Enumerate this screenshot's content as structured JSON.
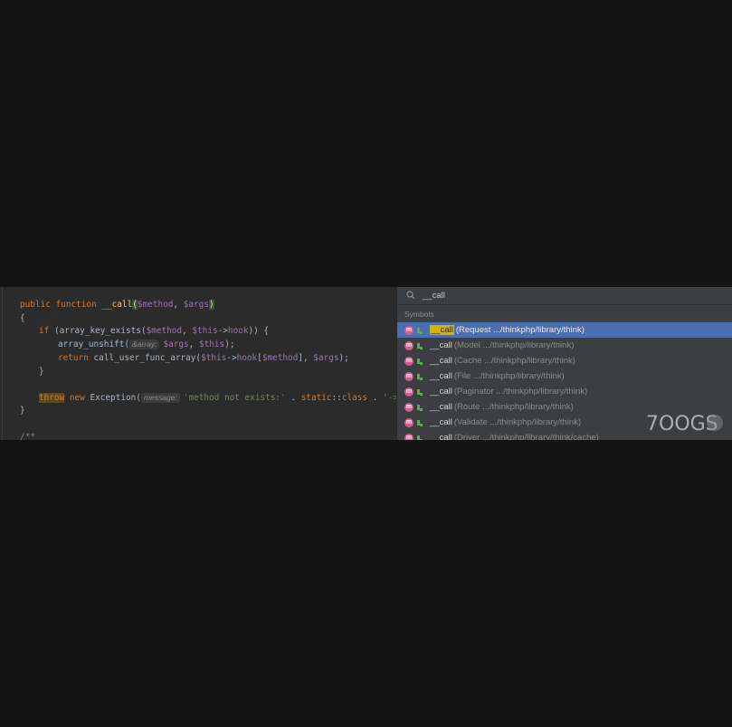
{
  "editor": {
    "lines": {
      "l1": {
        "kw1": "public",
        "kw2": "function",
        "fn": "__call",
        "open": "(",
        "var1": "$method",
        "sep": ",",
        "var2": "$args",
        "close": ")"
      },
      "l2": {
        "text": "{"
      },
      "l3": {
        "kw": "if",
        "p1": "(array_key_exists(",
        "v1": "$method",
        "sep": ",",
        "v2": "$this",
        "arrow": "->",
        "prop": "hook",
        "p2": ")) {"
      },
      "l4": {
        "fn": "array_unshift(",
        "hint": "&array:",
        "v1": "$args",
        "sep": ",",
        "v2": "$this",
        "p2": ");"
      },
      "l5": {
        "kw": "return",
        "fn": "call_user_func_array(",
        "v1": "$this",
        "arrow": "->",
        "prop": "hook",
        "b1": "[",
        "v2": "$method",
        "b2": "],",
        "v3": "$args",
        "p2": ");"
      },
      "l6": {
        "text": "}"
      },
      "l7": {
        "kw1": "throw",
        "kw2": "new",
        "cls": "Exception(",
        "hint": "message:",
        "str1": "'method not exists:'",
        "dot1": ".",
        "kw3": "static",
        "dc": "::",
        "kw4": "class",
        "dot2": ".",
        "str2": "'->'",
        "dot3": "."
      },
      "l8": {
        "text": "}"
      },
      "l9": {
        "text": "/**"
      }
    }
  },
  "popup": {
    "search_value": "__call",
    "section_label": "Symbols",
    "badge": "m",
    "results": [
      {
        "name": "__call",
        "location": "(Request .../thinkphp/library/think)",
        "selected": true
      },
      {
        "name": "__call",
        "location": "(Model .../thinkphp/library/think)"
      },
      {
        "name": "__call",
        "location": "(Cache .../thinkphp/library/think)"
      },
      {
        "name": "__call",
        "location": "(File .../thinkphp/library/think)"
      },
      {
        "name": "__call",
        "location": "(Paginator .../thinkphp/library/think)"
      },
      {
        "name": "__call",
        "location": "(Route .../thinkphp/library/think)"
      },
      {
        "name": "__call",
        "location": "(Validate .../thinkphp/library/think)"
      },
      {
        "name": "__call",
        "location": "(Driver .../thinkphp/library/think/cache)"
      }
    ]
  },
  "colors": {
    "background": "#141414",
    "editor_bg": "#2b2b2b",
    "popup_bg": "#3c3f41",
    "selection": "#4b6eaf",
    "match_highlight": "#d7b200",
    "method_badge": "#d55b8a"
  },
  "icons": {
    "search": "search-icon",
    "method": "method-badge-icon",
    "visibility": "public-visibility-icon"
  },
  "watermark": {
    "logo": "7OOGS"
  }
}
